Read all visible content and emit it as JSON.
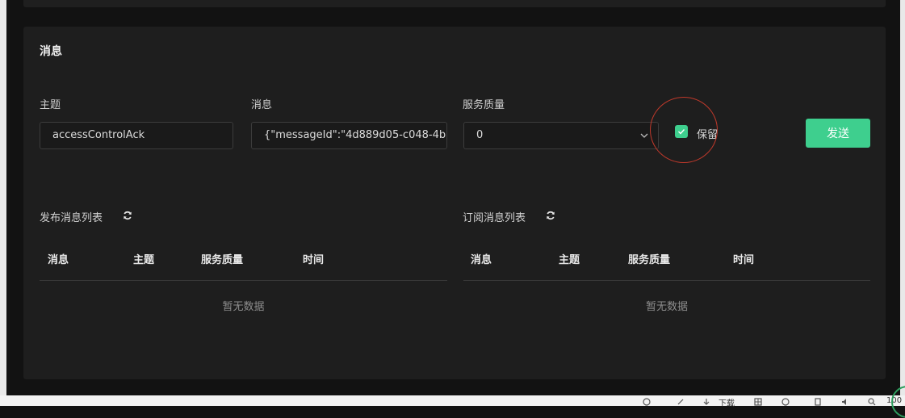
{
  "message_section": {
    "title": "消息",
    "topic_label": "主题",
    "topic_value": "accessControlAck",
    "message_label": "消息",
    "message_value": "{\"messageId\":\"4d889d05-c048-4b",
    "qos_label": "服务质量",
    "qos_value": "0",
    "retain_label": "保留",
    "retain_checked": true,
    "send_label": "发送"
  },
  "publish_list": {
    "title": "发布消息列表",
    "columns": [
      "消息",
      "主题",
      "服务质量",
      "时间"
    ],
    "empty_text": "暂无数据"
  },
  "subscribe_list": {
    "title": "订阅消息列表",
    "columns": [
      "消息",
      "主题",
      "服务质量",
      "时间"
    ],
    "empty_text": "暂无数据"
  },
  "taskbar": {
    "download_label": "下载",
    "zoom_text": "100"
  },
  "colors": {
    "accent": "#3ecf8e",
    "annotation": "#c0392b",
    "card_bg": "#1e1e1e",
    "page_bg": "#121212"
  }
}
